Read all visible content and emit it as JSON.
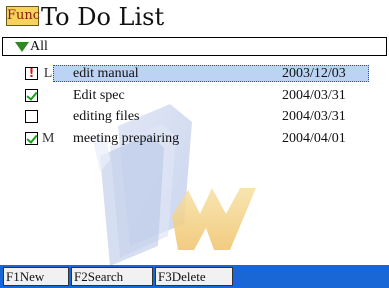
{
  "app": {
    "func_label": "Func",
    "title": "To Do List"
  },
  "filter": {
    "selected": "All",
    "icon": "triangle-down-icon"
  },
  "tasks": [
    {
      "status": "important",
      "priority": "L",
      "name": "edit manual",
      "date": "2003/12/03",
      "selected": true
    },
    {
      "status": "done",
      "priority": "",
      "name": "Edit spec",
      "date": "2004/03/31",
      "selected": false
    },
    {
      "status": "open",
      "priority": "",
      "name": "editing files",
      "date": "2004/03/31",
      "selected": false
    },
    {
      "status": "done",
      "priority": "M",
      "name": "meeting prepairing",
      "date": "2004/04/01",
      "selected": false
    }
  ],
  "function_keys": [
    {
      "key": "F1",
      "label": "New"
    },
    {
      "key": "F2",
      "label": "Search"
    },
    {
      "key": "F3",
      "label": "Delete"
    }
  ],
  "colors": {
    "func_bg": "#f6d35c",
    "selection": "#bcd3f4",
    "function_bar": "#1966d6",
    "check": "#16a01a",
    "filter_icon": "#2e8b1e"
  }
}
